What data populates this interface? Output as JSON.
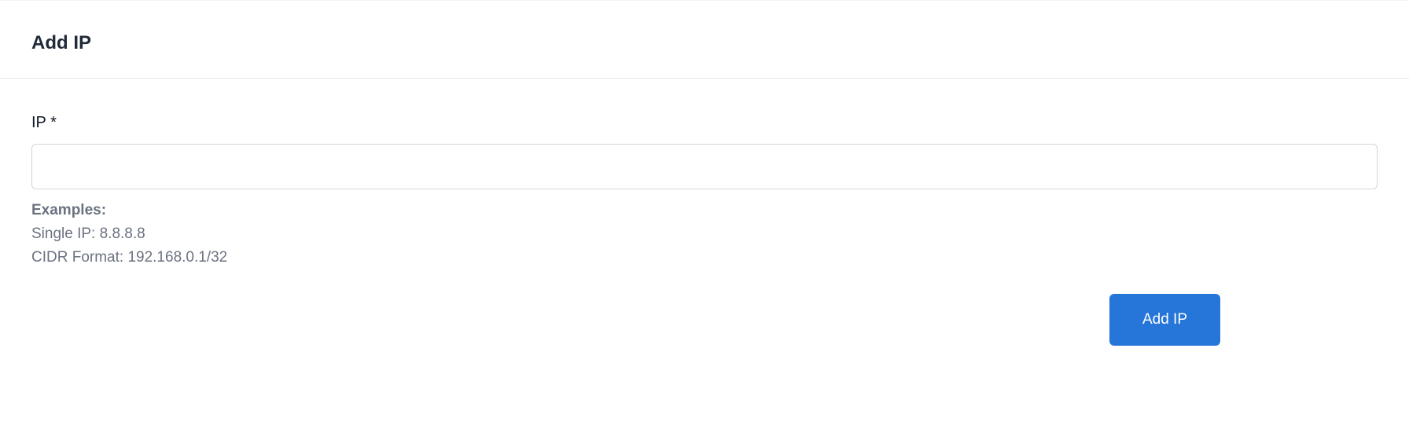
{
  "header": {
    "title": "Add IP"
  },
  "form": {
    "ip_label": "IP *",
    "ip_value": "",
    "examples_heading": "Examples:",
    "example_single": "Single IP: 8.8.8.8",
    "example_cidr": "CIDR Format: 192.168.0.1/32",
    "submit_label": "Add IP"
  }
}
